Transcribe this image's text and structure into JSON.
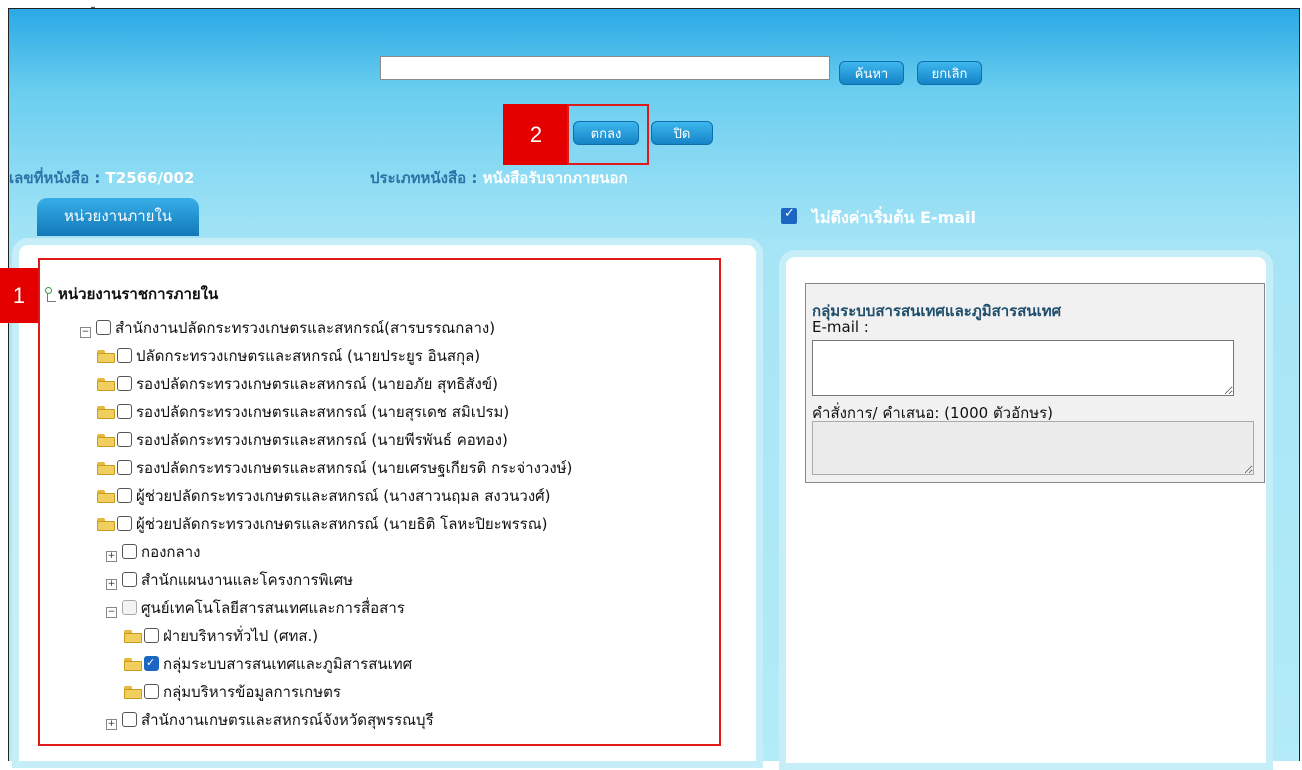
{
  "search": {
    "value": "",
    "find_label": "ค้นหา",
    "cancel_label": "ยกเลิก"
  },
  "actions": {
    "ok_label": "ตกลง",
    "close_label": "ปิด"
  },
  "markers": {
    "tree_marker": "1",
    "ok_marker": "2",
    "marker_color": "#e50000"
  },
  "doc": {
    "number_label": "เลขที่หนังสือ : ",
    "number_value": "T2566/002",
    "type_label": "ประเภทหนังสือ : ",
    "type_value": "หนังสือรับจากภายนอก"
  },
  "tab_label": "หน่วยงานภายใน",
  "email_option": {
    "label": "ไม่ดึงค่าเริ่มต้น E-mail",
    "checked": true
  },
  "tree": {
    "root": "หน่วยงานราชการภายใน",
    "items": [
      {
        "label": "สำนักงานปลัดกระทรวงเกษตรและสหกรณ์(สารบรรณกลาง)",
        "icon": "minus",
        "checked": false
      },
      {
        "label": "ปลัดกระทรวงเกษตรและสหกรณ์ (นายประยูร อินสกุล)",
        "icon": "folder",
        "checked": false
      },
      {
        "label": "รองปลัดกระทรวงเกษตรและสหกรณ์ (นายอภัย สุทธิสังข์)",
        "icon": "folder",
        "checked": false
      },
      {
        "label": "รองปลัดกระทรวงเกษตรและสหกรณ์ (นายสุรเดช สมิเปรม)",
        "icon": "folder",
        "checked": false
      },
      {
        "label": "รองปลัดกระทรวงเกษตรและสหกรณ์ (นายพีรพันธ์ คอทอง)",
        "icon": "folder",
        "checked": false
      },
      {
        "label": "รองปลัดกระทรวงเกษตรและสหกรณ์ (นายเศรษฐเกียรติ กระจ่างวงษ์)",
        "icon": "folder",
        "checked": false
      },
      {
        "label": "ผู้ช่วยปลัดกระทรวงเกษตรและสหกรณ์ (นางสาวนฤมล สงวนวงศ์)",
        "icon": "folder",
        "checked": false
      },
      {
        "label": "ผู้ช่วยปลัดกระทรวงเกษตรและสหกรณ์ (นายธิติ โลหะปิยะพรรณ)",
        "icon": "folder",
        "checked": false
      },
      {
        "label": "กองกลาง",
        "icon": "plus",
        "checked": false
      },
      {
        "label": "สำนักแผนงานและโครงการพิเศษ",
        "icon": "plus",
        "checked": false
      },
      {
        "label": "ศูนย์เทคโนโลยีสารสนเทศและการสื่อสาร",
        "icon": "minus",
        "checked": false
      },
      {
        "label": "ฝ่ายบริหารทั่วไป (ศทส.)",
        "icon": "folder",
        "checked": false
      },
      {
        "label": "กลุ่มระบบสารสนเทศและภูมิสารสนเทศ",
        "icon": "folder",
        "checked": true
      },
      {
        "label": "กลุ่มบริหารข้อมูลการเกษตร",
        "icon": "folder",
        "checked": false
      },
      {
        "label": "สำนักงานเกษตรและสหกรณ์จังหวัดสุพรรณบุรี",
        "icon": "plus",
        "checked": false
      }
    ]
  },
  "detail": {
    "group_title": "กลุ่มระบบสารสนเทศและภูมิสารสนเทศ",
    "email_label": "E-mail :",
    "email_value": "",
    "order_label": "คำสั่งการ/ คำเสนอ: (1000 ตัวอักษร)",
    "order_value": ""
  }
}
